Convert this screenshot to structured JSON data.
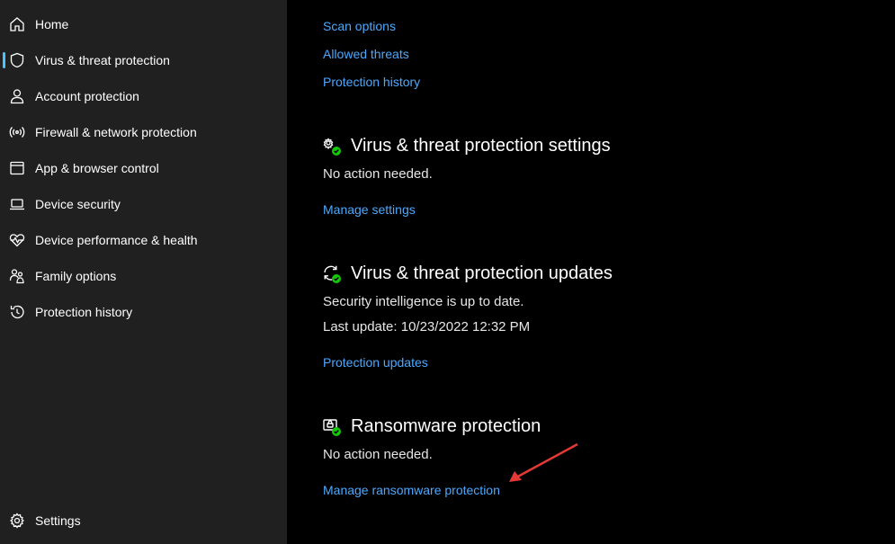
{
  "sidebar": {
    "items": [
      {
        "label": "Home",
        "icon": "home-icon"
      },
      {
        "label": "Virus & threat protection",
        "icon": "shield-icon",
        "selected": true
      },
      {
        "label": "Account protection",
        "icon": "person-icon"
      },
      {
        "label": "Firewall & network protection",
        "icon": "wifi-signal-icon"
      },
      {
        "label": "App & browser control",
        "icon": "browser-window-icon"
      },
      {
        "label": "Device security",
        "icon": "laptop-icon"
      },
      {
        "label": "Device performance & health",
        "icon": "heart-pulse-icon"
      },
      {
        "label": "Family options",
        "icon": "family-icon"
      },
      {
        "label": "Protection history",
        "icon": "history-icon"
      }
    ],
    "settings_label": "Settings"
  },
  "main": {
    "top_links": [
      "Scan options",
      "Allowed threats",
      "Protection history"
    ],
    "settings_section": {
      "title": "Virus & threat protection settings",
      "status": "No action needed.",
      "link": "Manage settings"
    },
    "updates_section": {
      "title": "Virus & threat protection updates",
      "status": "Security intelligence is up to date.",
      "last_update": "Last update: 10/23/2022 12:32 PM",
      "link": "Protection updates"
    },
    "ransomware_section": {
      "title": "Ransomware protection",
      "status": "No action needed.",
      "link": "Manage ransomware protection"
    }
  },
  "colors": {
    "sidebar_bg": "#202020",
    "main_bg": "#000000",
    "link": "#4ca9ff",
    "selection_accent": "#4cc2ff",
    "ok_badge": "#16c60c",
    "annotation_arrow": "#e53935"
  }
}
